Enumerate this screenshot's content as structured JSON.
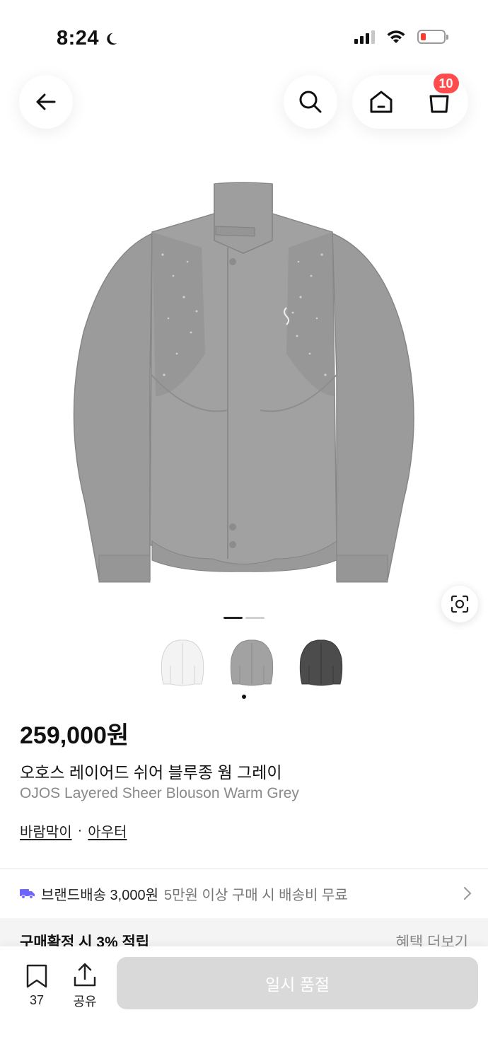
{
  "status_bar": {
    "time": "8:24"
  },
  "nav": {
    "cart_count": "10"
  },
  "gallery": {
    "current_index": 1,
    "total": 2
  },
  "colors": {
    "options": [
      "white",
      "grey",
      "charcoal"
    ],
    "selected_index": 1
  },
  "product": {
    "price": "259,000원",
    "name_kr": "오호스 레이어드 쉬어 블루종 웜 그레이",
    "name_en": "OJOS Layered Sheer Blouson Warm Grey",
    "category_1": "바람막이",
    "category_sep": "·",
    "category_2": "아우터"
  },
  "delivery": {
    "label": "브랜드배송 3,000원",
    "note": "5만원 이상 구매 시 배송비 무료"
  },
  "benefit": {
    "points_label": "구매확정 시 3% 적립",
    "more_label": "혜택 더보기"
  },
  "bottom_bar": {
    "bookmark_count": "37",
    "share_label": "공유",
    "soldout_label": "일시 품절"
  },
  "theme": {
    "badge_color": "#ff4b4b",
    "truck_color": "#6f64ff",
    "button_disabled": "#d9d9d9"
  }
}
